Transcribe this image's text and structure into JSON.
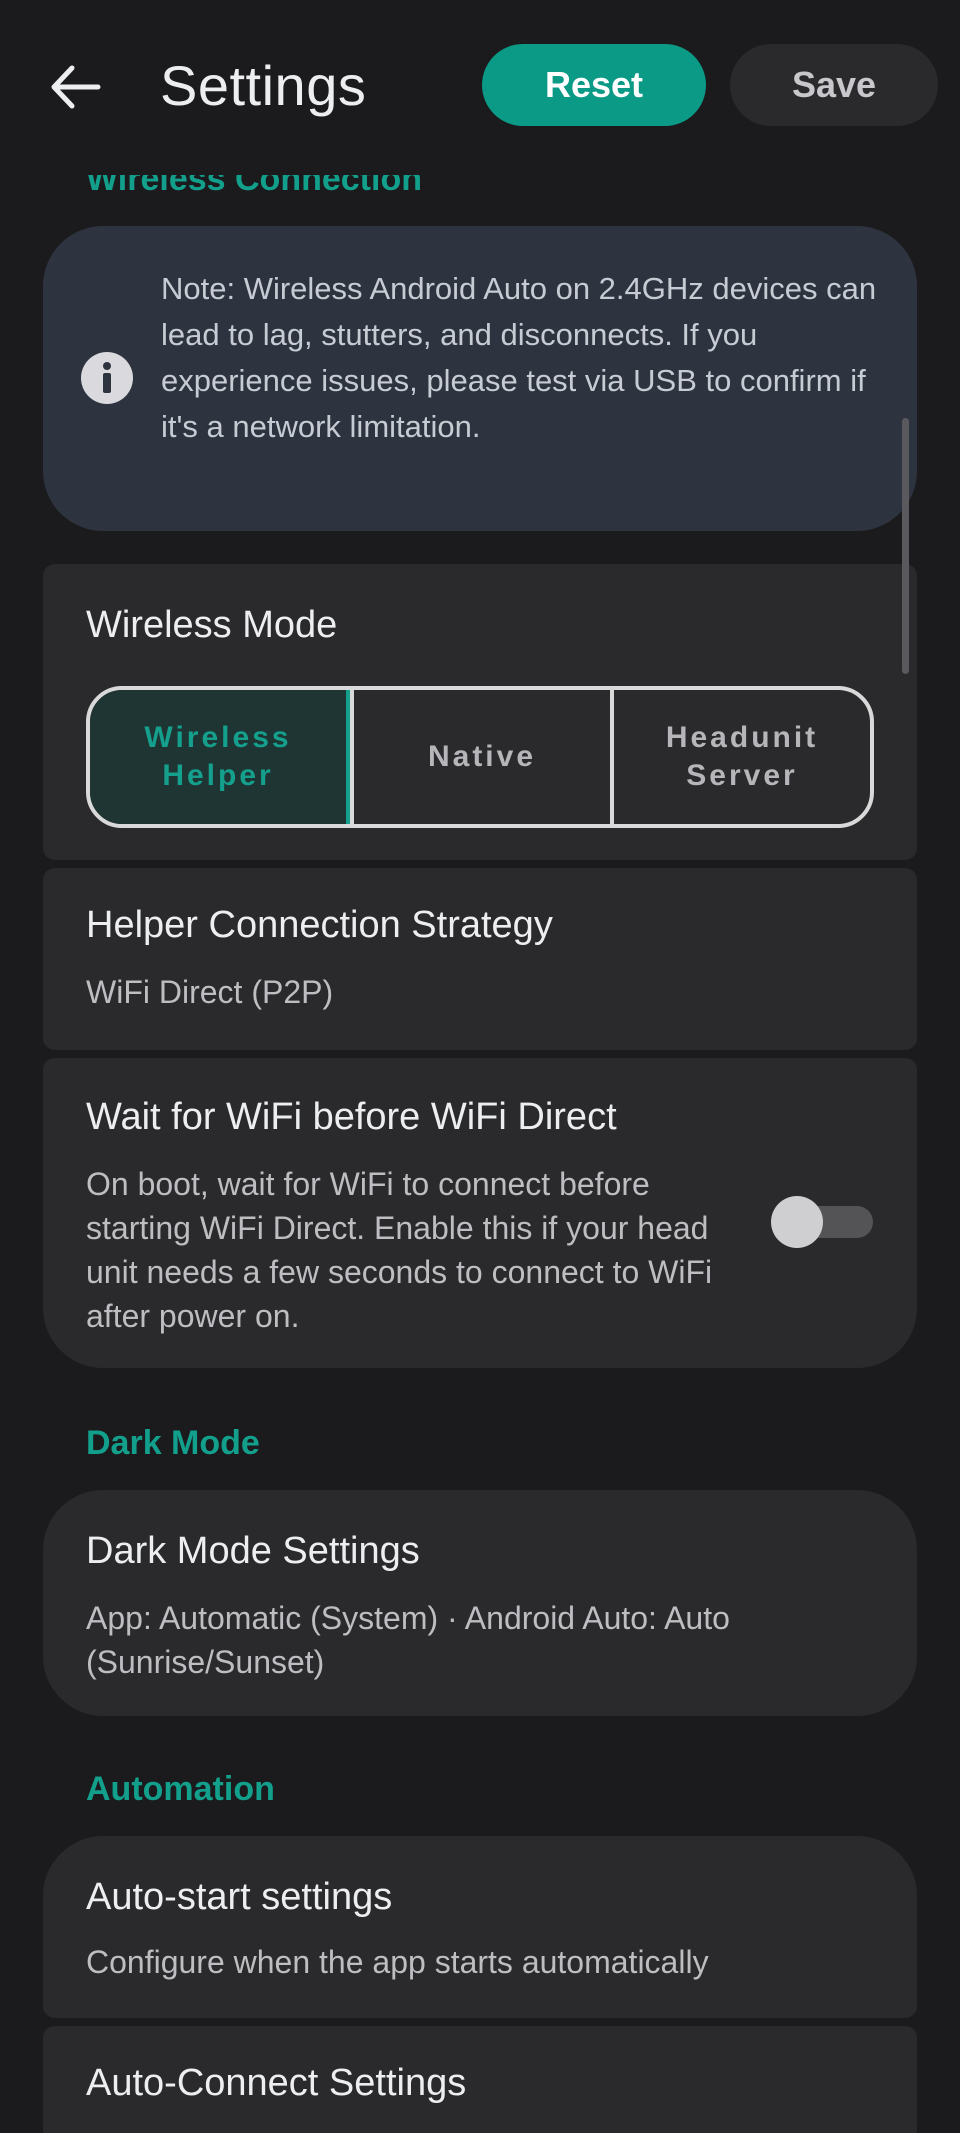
{
  "header": {
    "title": "Settings",
    "reset_label": "Reset",
    "save_label": "Save"
  },
  "sections": {
    "wireless": {
      "header": "Wireless Connection",
      "note": "Note: Wireless Android Auto on 2.4GHz devices can lead to lag, stutters, and disconnects. If you experience issues, please test via USB to confirm if it's a network limitation.",
      "mode": {
        "title": "Wireless Mode",
        "options": [
          "Wireless Helper",
          "Native",
          "Headunit Server"
        ],
        "selected": "Wireless Helper"
      },
      "strategy": {
        "title": "Helper Connection Strategy",
        "value": "WiFi Direct (P2P)"
      },
      "wait_wifi": {
        "title": "Wait for WiFi before WiFi Direct",
        "description": "On boot, wait for WiFi to connect before starting WiFi Direct. Enable this if your head unit needs a few seconds to connect to WiFi after power on.",
        "enabled": false
      }
    },
    "dark_mode": {
      "header": "Dark Mode",
      "settings": {
        "title": "Dark Mode Settings",
        "value": "App: Automatic (System) · Android Auto: Auto (Sunrise/Sunset)"
      }
    },
    "automation": {
      "header": "Automation",
      "autostart": {
        "title": "Auto-start settings",
        "value": "Configure when the app starts automatically"
      },
      "autoconnect": {
        "title": "Auto-Connect Settings"
      }
    }
  },
  "colors": {
    "accent": "#0b9a86",
    "background": "#1b1b1d",
    "card": "#2a2a2c",
    "note_card": "#2e343f"
  },
  "icons": {
    "back": "arrow-left-icon",
    "info": "info-icon"
  }
}
